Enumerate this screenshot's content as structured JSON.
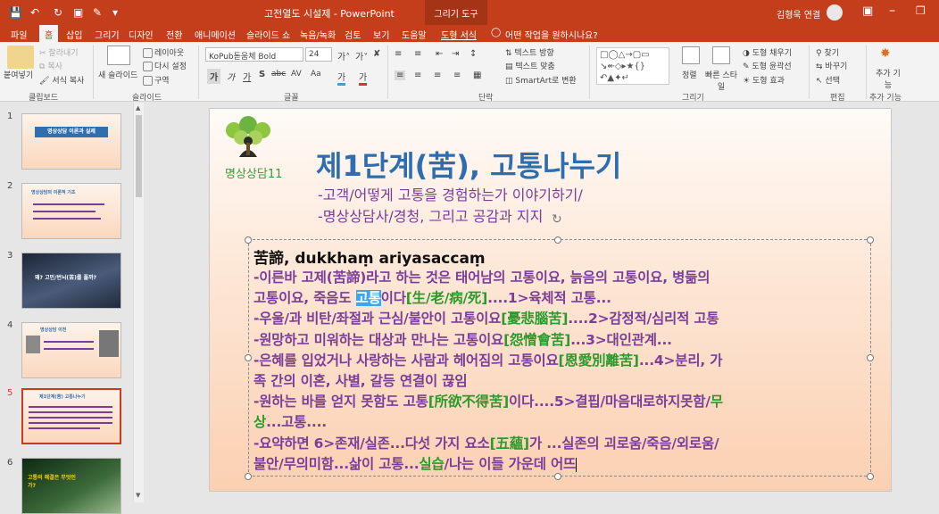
{
  "titlebar": {
    "doc_title": "고전열도 시설제 - PowerPoint",
    "context": "그리기 도구",
    "user": "김형욱 연결",
    "quick_access": [
      "💾",
      "↶",
      "↻",
      "▾"
    ]
  },
  "tabs": [
    "파일",
    "홈",
    "삽입",
    "그리기",
    "디자인",
    "전환",
    "애니메이션",
    "슬라이드 쇼",
    "녹음/녹화",
    "검토",
    "보기",
    "도움말",
    "도형 서식"
  ],
  "tell_me": "어떤 작업을 원하시나요?",
  "ribbon": {
    "clipboard": {
      "paste": "붙여넣기",
      "cut": "잘라내기",
      "copy": "복사",
      "format_painter": "서식 복사",
      "label": "클립보드"
    },
    "slides": {
      "new_slide": "새 슬라이드",
      "layout": "레이아웃",
      "reset": "다시 설정",
      "section": "구역",
      "label": "슬라이드"
    },
    "font": {
      "name": "KoPub돋움체 Bold",
      "size": "24",
      "label": "글꼴",
      "buttons": [
        "가",
        "가",
        "가",
        "S",
        "abc",
        "AV",
        "Aa",
        "가",
        "가"
      ]
    },
    "paragraph": {
      "label": "단락",
      "text_direction": "텍스트 방향",
      "align_text": "텍스트 맞춤",
      "smartart": "SmartArt로 변환"
    },
    "drawing": {
      "label": "그리기",
      "arrange": "정렬",
      "quick_styles": "빠른 스타일",
      "fill": "도형 채우기",
      "outline": "도형 윤곽선",
      "effects": "도형 효과"
    },
    "editing": {
      "label": "편집",
      "find": "찾기",
      "replace": "바꾸기",
      "select": "선택"
    },
    "addins": {
      "label": "추가 기능",
      "addin": "추가 기능"
    }
  },
  "thumbnails": [
    {
      "num": "1",
      "text": "명상상담 이론과 실제"
    },
    {
      "num": "2",
      "text": "명상상담의 이론적 기초"
    },
    {
      "num": "3",
      "text": "왜? 고민/번뇌(苦)를 풀까?"
    },
    {
      "num": "4",
      "text": "명상상담 이전"
    },
    {
      "num": "5",
      "text": "제1단계(苦) 고통나누기"
    },
    {
      "num": "6",
      "text": "고통의 해결은 무엇인가?"
    }
  ],
  "slide": {
    "logo_text": "명상상담11",
    "title": "제1단계(苦), 고통나누기",
    "subtitle1": "-고객/어떻게 고통을 경험하는가 이야기하기/",
    "subtitle2": "-명상상담사/경청, 그리고 공감과 지지",
    "heading": "苦諦, dukkhaṃ ariyasaccaṃ",
    "lines": [
      [
        {
          "t": "-이른바 고제(苦諦)라고 하는 것은 태어남의 고통이요, 늙음의 고통이요, 병듦의",
          "c": "purple"
        }
      ],
      [
        {
          "t": "고통이요, 죽음도 ",
          "c": "purple"
        },
        {
          "t": "고통",
          "c": "hl"
        },
        {
          "t": "이다",
          "c": "purple"
        },
        {
          "t": "[生/老/病/死]",
          "c": "green"
        },
        {
          "t": "....1>육체적 고통...",
          "c": "purple"
        }
      ],
      [
        {
          "t": "-우울/과 비탄/좌절과 근심/불안이 고통이요",
          "c": "purple"
        },
        {
          "t": "[憂悲腦苦]",
          "c": "green"
        },
        {
          "t": "....2>감정적/심리적 고통",
          "c": "purple"
        }
      ],
      [
        {
          "t": "-원망하고 미워하는 대상과 만나는 고통이요",
          "c": "purple"
        },
        {
          "t": "[怨憎會苦]",
          "c": "green"
        },
        {
          "t": "...3>대인관계...",
          "c": "purple"
        }
      ],
      [
        {
          "t": "-은혜를 입었거나 사랑하는 사람과 헤어짐의 고통이요",
          "c": "purple"
        },
        {
          "t": "[恩愛別離苦]",
          "c": "green"
        },
        {
          "t": "...4>분리, 가",
          "c": "purple"
        }
      ],
      [
        {
          "t": "족 간의 이혼, 사별, 갈등 연결이 끊임",
          "c": "purple"
        }
      ],
      [
        {
          "t": "-원하는 바를 얻지 못함도 고통",
          "c": "purple"
        },
        {
          "t": "[所欲不得苦]",
          "c": "green"
        },
        {
          "t": "이다....5>결핍/마음대로하지못함/",
          "c": "purple"
        },
        {
          "t": "무",
          "c": "green"
        }
      ],
      [
        {
          "t": "상",
          "c": "green"
        },
        {
          "t": "...고통....",
          "c": "purple"
        }
      ],
      [
        {
          "t": "-요약하면 6>존재/실존...다섯 가지 요소",
          "c": "purple"
        },
        {
          "t": "[五蘊]",
          "c": "green"
        },
        {
          "t": "가 ...실존의 괴로움/죽음/외로움/",
          "c": "purple"
        }
      ],
      [
        {
          "t": "불안/무의미함...",
          "c": "purple"
        },
        {
          "t": "삶이 고통",
          "c": "purple"
        },
        {
          "t": "...",
          "c": "purple"
        },
        {
          "t": "실습",
          "c": "green"
        },
        {
          "t": "/나는 이들 가운데 어뜨",
          "c": "purple"
        }
      ]
    ]
  }
}
